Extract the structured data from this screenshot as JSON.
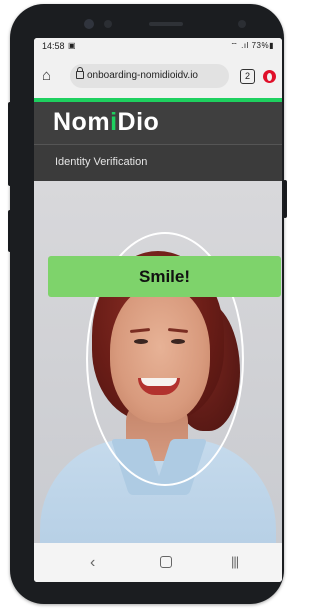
{
  "status_bar": {
    "time": "14:58",
    "sim_indicator": "▣",
    "icons": "⌔ .ıl 73%▮"
  },
  "browser": {
    "url": "onboarding-nomidioidv.io",
    "tab_count": "2",
    "home_icon": "home-icon",
    "lock_icon": "lock-icon",
    "menu_icon": "opera-icon"
  },
  "app": {
    "logo": {
      "before": "Nom",
      "accent": "i",
      "after": "Dio"
    },
    "subtitle": "Identity Verification",
    "prompt": "Smile!",
    "accent_color": "#1ed05f",
    "prompt_color": "#7ed36b"
  },
  "nav": {
    "back": "‹",
    "home": "",
    "recent": "|||"
  }
}
